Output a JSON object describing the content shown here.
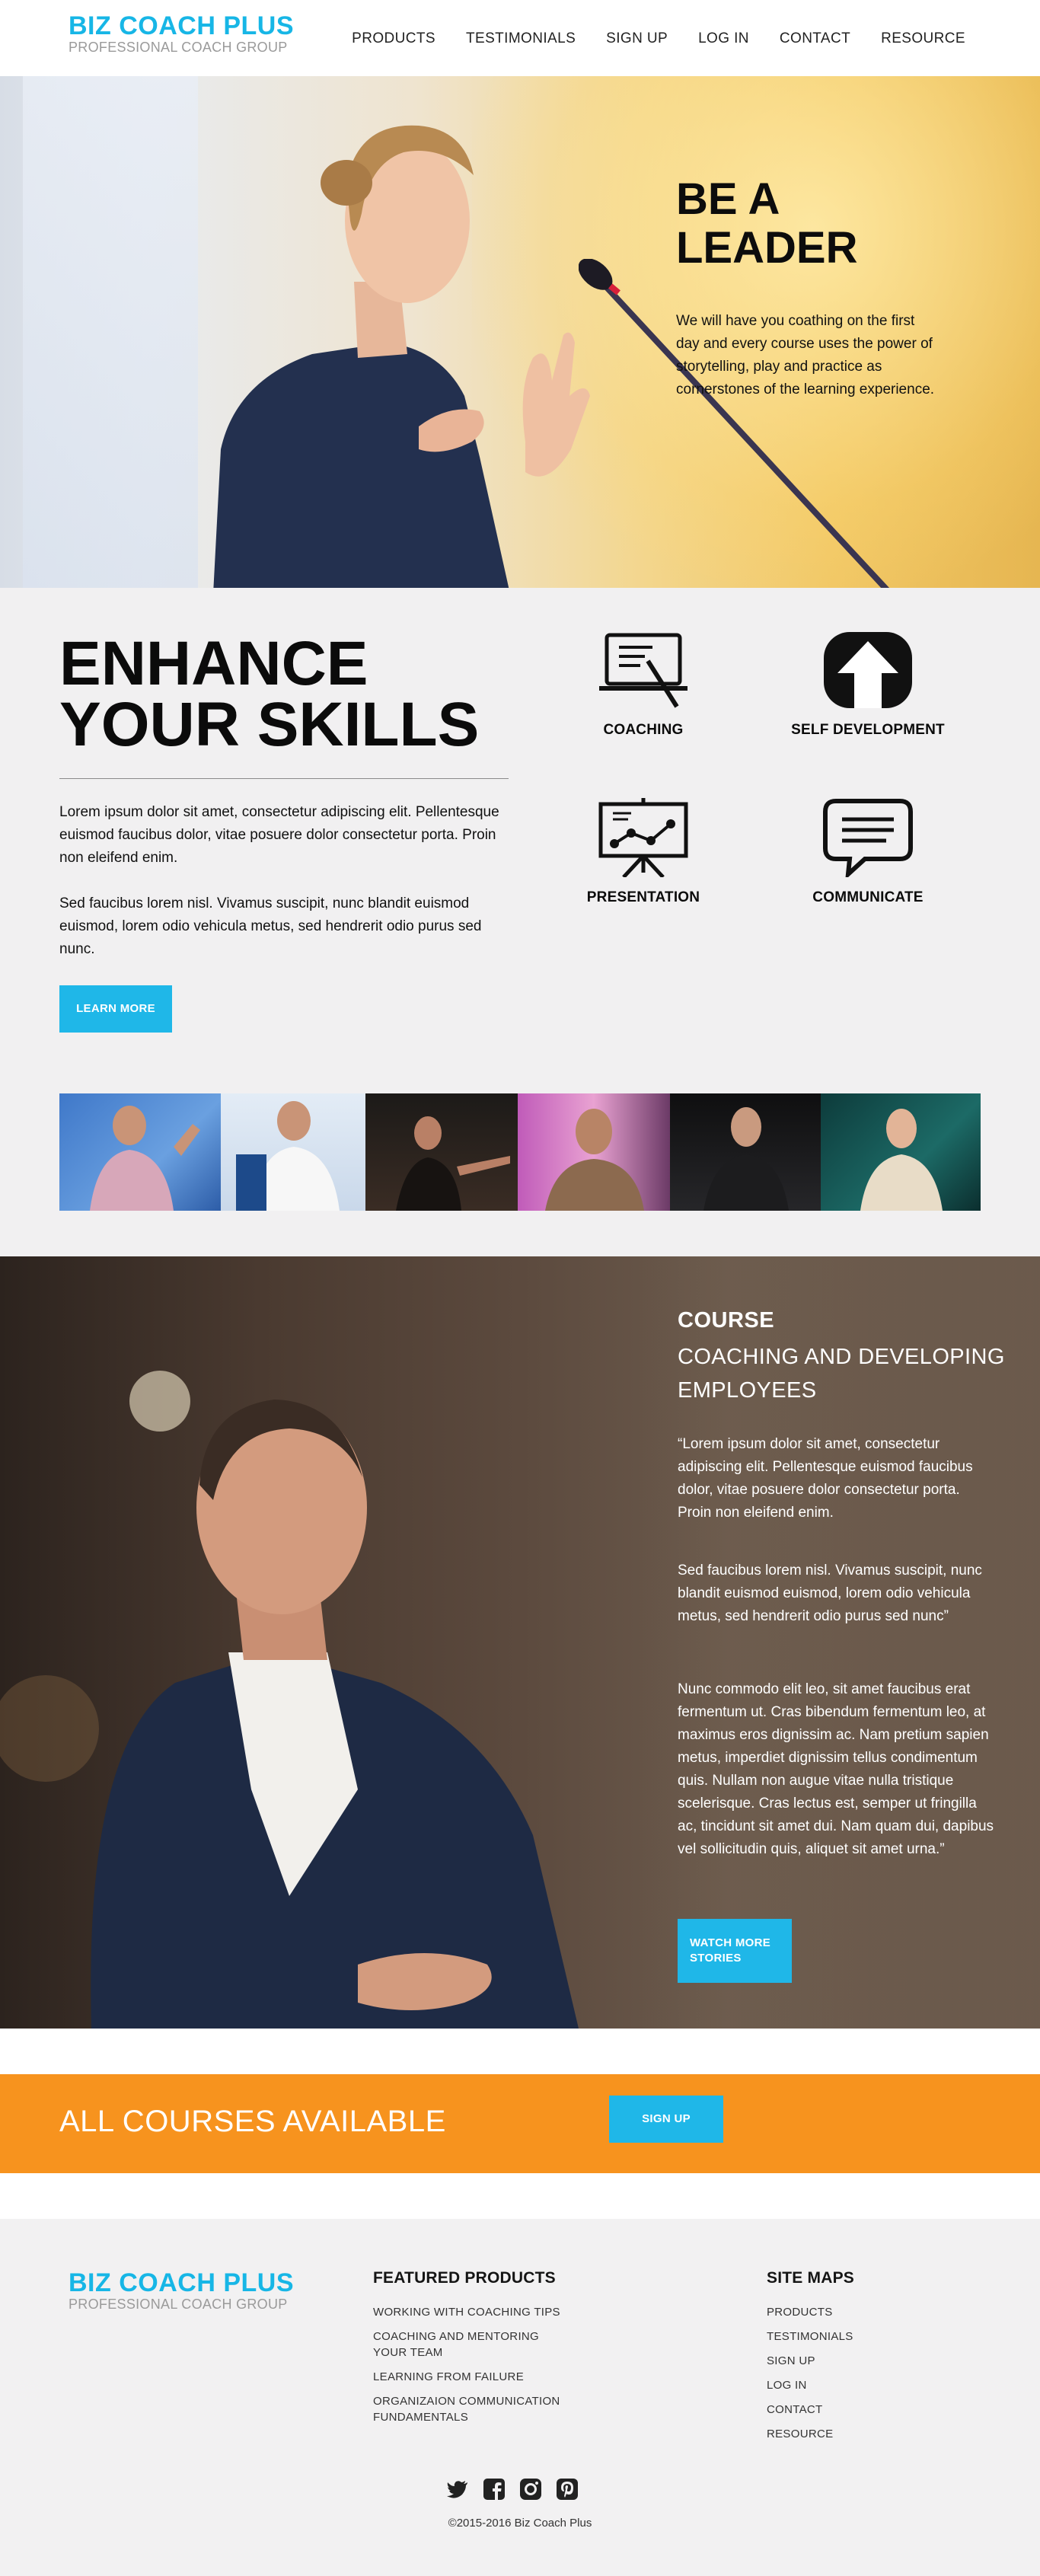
{
  "brand": {
    "name": "BIZ COACH PLUS",
    "tagline": "PROFESSIONAL COACH GROUP",
    "accent_color": "#17b6e6",
    "cta_color": "#f7931e"
  },
  "nav": {
    "items": [
      "PRODUCTS",
      "TESTIMONIALS",
      "SIGN UP",
      "LOG IN",
      "CONTACT",
      "RESOURCE"
    ]
  },
  "hero": {
    "title_line1": "BE A",
    "title_line2": "LEADER",
    "text": "We will have you coathing on the first day and every course uses the power of storytelling, play and practice as cornerstones of the learning experience."
  },
  "skills": {
    "title_line1": "ENHANCE",
    "title_line2": "YOUR SKILLS",
    "paragraph1": "Lorem ipsum dolor sit amet, consectetur adipiscing elit. Pellentesque euismod faucibus dolor, vitae posuere dolor consectetur porta. Proin non eleifend enim.",
    "paragraph2": "Sed faucibus lorem nisl. Vivamus suscipit, nunc blandit euismod euismod, lorem odio vehicula metus, sed hendrerit odio purus sed nunc.",
    "button": "LEARN MORE",
    "features": [
      {
        "label": "COACHING",
        "icon": "whiteboard-pen-icon"
      },
      {
        "label": "SELF DEVELOPMENT",
        "icon": "arrow-up-icon"
      },
      {
        "label": "PRESENTATION",
        "icon": "presentation-chart-icon"
      },
      {
        "label": "COMMUNICATE",
        "icon": "speech-bubble-icon"
      }
    ]
  },
  "course": {
    "heading": "COURSE",
    "subheading": "COACHING AND DEVELOPING EMPLOYEES",
    "paragraph1": "“Lorem ipsum dolor sit amet, consectetur adipiscing elit. Pellentesque euismod faucibus dolor, vitae posuere dolor consectetur porta. Proin non eleifend enim.",
    "paragraph2": "Sed faucibus lorem nisl. Vivamus suscipit, nunc blandit euismod euismod, lorem odio vehicula metus, sed hendrerit odio purus sed nunc”",
    "paragraph3": "Nunc commodo elit leo, sit amet faucibus erat fermentum ut. Cras bibendum fermentum leo, at maximus eros dignissim ac. Nam pretium sapien metus, imperdiet dignissim tellus condimentum quis. Nullam non augue vitae nulla tristique scelerisque. Cras lectus est, semper ut fringilla ac, tincidunt sit amet dui. Nam quam dui, dapibus vel sollicitudin quis, aliquet sit amet urna.”",
    "button": "WATCH MORE STORIES"
  },
  "cta": {
    "text": "ALL COURSES AVAILABLE",
    "button": "SIGN UP"
  },
  "footer": {
    "featured_title": "FEATURED PRODUCTS",
    "featured_items": [
      "WORKING WITH COACHING TIPS",
      "COACHING AND MENTORING YOUR TEAM",
      "LEARNING FROM FAILURE",
      "ORGANIZAION COMMUNICATION FUNDAMENTALS"
    ],
    "sitemap_title": "SITE MAPS",
    "sitemap_items": [
      "PRODUCTS",
      "TESTIMONIALS",
      "SIGN UP",
      "LOG IN",
      "CONTACT",
      "RESOURCE"
    ],
    "socials": [
      "twitter-icon",
      "facebook-icon",
      "instagram-icon",
      "pinterest-icon"
    ],
    "copyright": "©2015-2016 Biz Coach Plus"
  }
}
